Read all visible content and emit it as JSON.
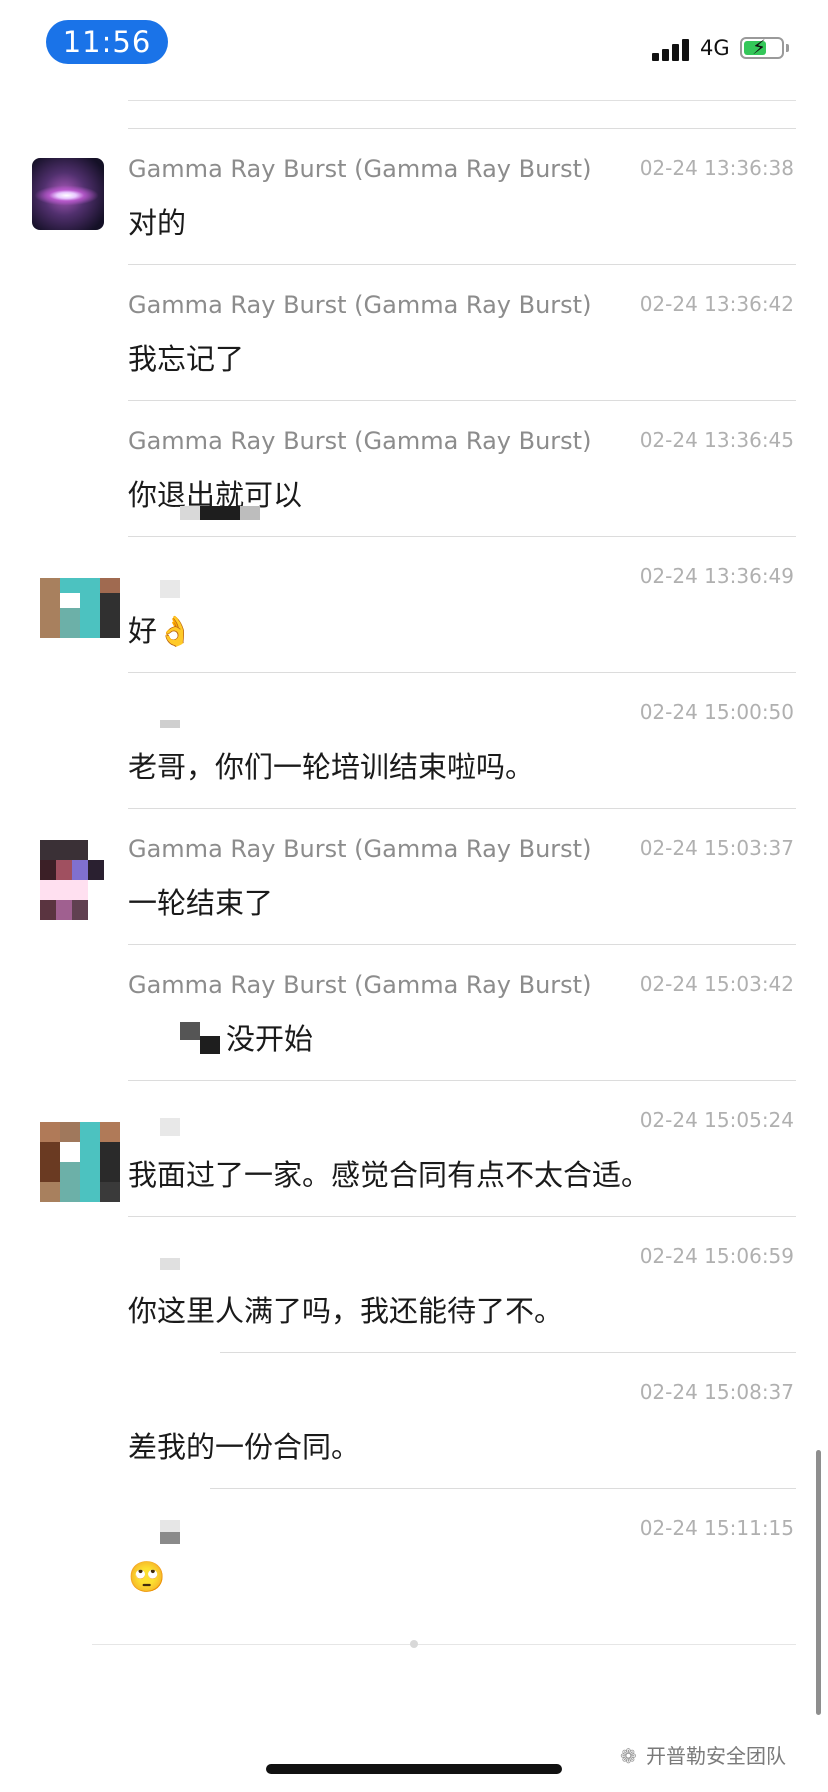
{
  "status_bar": {
    "time": "11:56",
    "network": "4G",
    "signal_icon": "signal-bars-icon",
    "battery_icon": "battery-charging-icon",
    "battery_color": "#34c759",
    "time_pill_color": "#1a73e8"
  },
  "messages": [
    {
      "sender": "Gamma Ray Burst (Gamma Ray Burst)",
      "time": "02-24 13:36:38",
      "text": "对的",
      "avatar": "galaxy"
    },
    {
      "sender": "Gamma Ray Burst (Gamma Ray Burst)",
      "time": "02-24 13:36:42",
      "text": "我忘记了"
    },
    {
      "sender": "Gamma Ray Burst (Gamma Ray Burst)",
      "time": "02-24 13:36:45",
      "text": "你退出就可以"
    },
    {
      "sender": "",
      "time": "02-24 13:36:49",
      "text": "好👌",
      "avatar": "mosaic-teal"
    },
    {
      "sender": "",
      "time": "02-24 15:00:50",
      "text": "老哥，你们一轮培训结束啦吗。"
    },
    {
      "sender": "Gamma Ray Burst (Gamma Ray Burst)",
      "time": "02-24 15:03:37",
      "text": "一轮结束了",
      "avatar": "mosaic-dark"
    },
    {
      "sender": "Gamma Ray Burst (Gamma Ray Burst)",
      "time": "02-24 15:03:42",
      "text": "没开始"
    },
    {
      "sender": "",
      "time": "02-24 15:05:24",
      "text": "我面过了一家。感觉合同有点不太合适。",
      "avatar": "mosaic-teal"
    },
    {
      "sender": "",
      "time": "02-24 15:06:59",
      "text": "你这里人满了吗，我还能待了不。"
    },
    {
      "sender": "",
      "time": "02-24 15:08:37",
      "text": "差我的一份合同。"
    },
    {
      "sender": "",
      "time": "02-24 15:11:15",
      "text": "🙄"
    }
  ],
  "footer": {
    "watermark": "开普勒安全团队",
    "watermark_icon": "wechat-icon"
  }
}
